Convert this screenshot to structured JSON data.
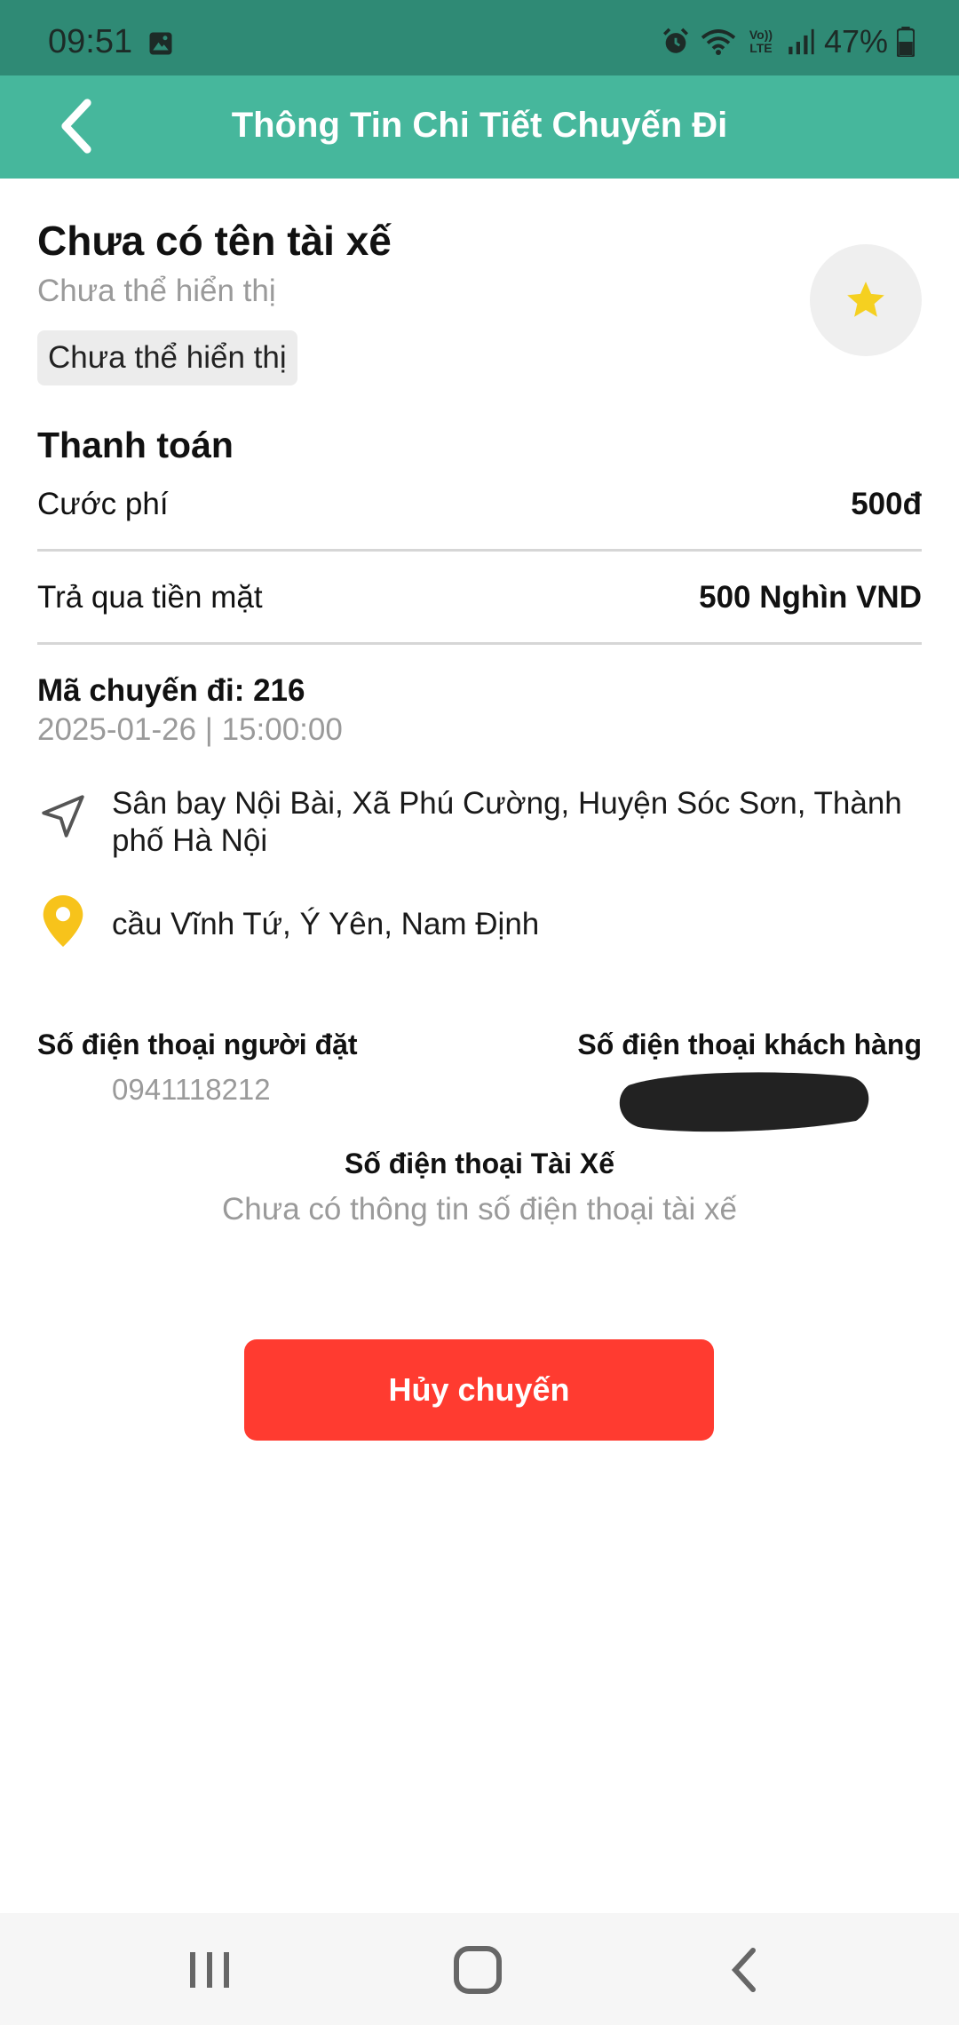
{
  "status_bar": {
    "time": "09:51",
    "battery": "47%",
    "volte": "Vo)) LTE"
  },
  "header": {
    "title": "Thông Tin Chi Tiết Chuyến Đi"
  },
  "driver": {
    "name": "Chưa có tên tài xế",
    "subtitle": "Chưa thể hiển thị",
    "chip": "Chưa thể hiển thị"
  },
  "payment": {
    "title": "Thanh toán",
    "fee_label": "Cước phí",
    "fee_value": "500đ",
    "method_label": "Trả qua tiền mặt",
    "method_value": "500 Nghìn VND"
  },
  "trip": {
    "code": "Mã chuyến đi: 216",
    "datetime": "2025-01-26 | 15:00:00",
    "pickup": "Sân bay Nội Bài, Xã Phú Cường, Huyện Sóc Sơn, Thành phố Hà Nội",
    "dropoff": "cầu Vĩnh Tứ, Ý Yên, Nam Định"
  },
  "contacts": {
    "booker_label": "Số điện thoại người đặt",
    "booker_phone": "0941118212",
    "customer_label": "Số điện thoại khách hàng",
    "driver_label": "Số điện thoại Tài Xế",
    "driver_phone": "Chưa có thông tin số điện thoại tài xế"
  },
  "actions": {
    "cancel_label": "Hủy chuyến"
  },
  "colors": {
    "status_bar": "#2f8a75",
    "app_bar": "#46b79c",
    "cancel": "#ff3b30",
    "star": "#f5d020",
    "pin": "#f7c31b"
  }
}
